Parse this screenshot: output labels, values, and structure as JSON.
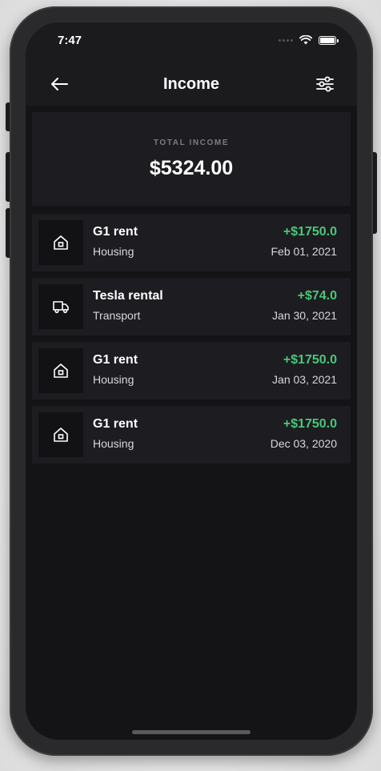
{
  "status_bar": {
    "time": "7:47",
    "wifi_icon": "wifi-icon",
    "battery_icon": "battery-icon"
  },
  "header": {
    "title": "Income",
    "back_icon": "arrow-left-icon",
    "filter_icon": "sliders-icon"
  },
  "summary": {
    "label": "TOTAL INCOME",
    "value": "$5324.00"
  },
  "transactions": [
    {
      "title": "G1 rent",
      "category": "Housing",
      "amount": "+$1750.0",
      "date": "Feb 01, 2021",
      "icon": "home-icon"
    },
    {
      "title": "Tesla rental",
      "category": "Transport",
      "amount": "+$74.0",
      "date": "Jan 30, 2021",
      "icon": "truck-icon"
    },
    {
      "title": "G1 rent",
      "category": "Housing",
      "amount": "+$1750.0",
      "date": "Jan 03, 2021",
      "icon": "home-icon"
    },
    {
      "title": "G1 rent",
      "category": "Housing",
      "amount": "+$1750.0",
      "date": "Dec 03, 2020",
      "icon": "home-icon"
    }
  ],
  "colors": {
    "background": "#141416",
    "card": "#1d1d21",
    "positive_amount": "#4cc67a",
    "text_primary": "#ffffff"
  }
}
